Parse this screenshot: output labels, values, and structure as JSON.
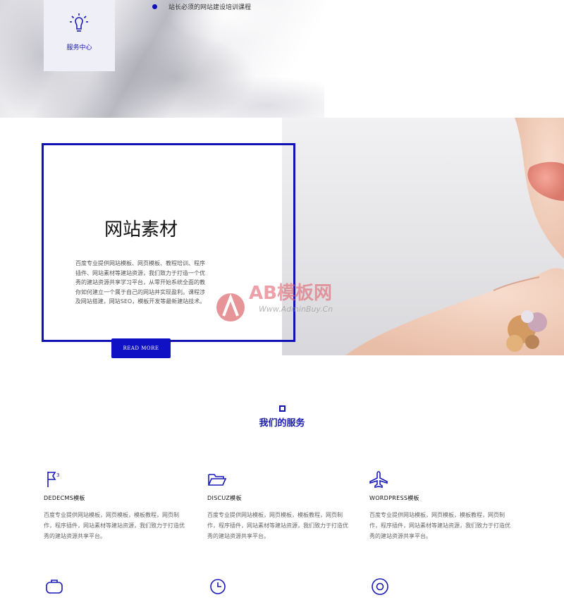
{
  "hero": {
    "service_center_label": "服务中心",
    "service_icon": "lightbulb-icon",
    "course_text": "站长必须的网站建设培训课程"
  },
  "materials": {
    "title": "网站素材",
    "description": "百度专业提供网站模板、网页模板、教程培训、程序插件、网站素材等建站资源，我们致力于打造一个优秀的建站资源共享学习平台，从零开始系统全面的教你如何建立一个属于自己的网站并实现盈利。课程涉及网站搭建，网站SEO，模板开发等最新建站技术。",
    "read_more": "READ MORE",
    "accent": "#1212b4"
  },
  "watermark": {
    "brand": "AB模板网",
    "url": "Www.AdminBuy.Cn"
  },
  "services": {
    "heading": "我们的服务",
    "cards": [
      {
        "icon": "flag-icon",
        "name": "DEDECMS模板",
        "text": "百度专业提供网站模板，网页模板，模板教程，网页制作，程序插件，网站素材等建站资源，我们致力于打造优秀的建站资源共享平台。"
      },
      {
        "icon": "folder-open-icon",
        "name": "DISCUZ模板",
        "text": "百度专业提供网站模板，网页模板，模板教程，网页制作，程序插件，网站素材等建站资源，我们致力于打造优秀的建站资源共享平台。"
      },
      {
        "icon": "airplane-icon",
        "name": "WORDPRESS模板",
        "text": "百度专业提供网站模板，网页模板，模板教程，网页制作，程序插件，网站素材等建站资源，我们致力于打造优秀的建站资源共享平台。"
      }
    ],
    "more_icons": [
      "briefcase-icon",
      "clock-icon",
      "target-icon"
    ]
  }
}
